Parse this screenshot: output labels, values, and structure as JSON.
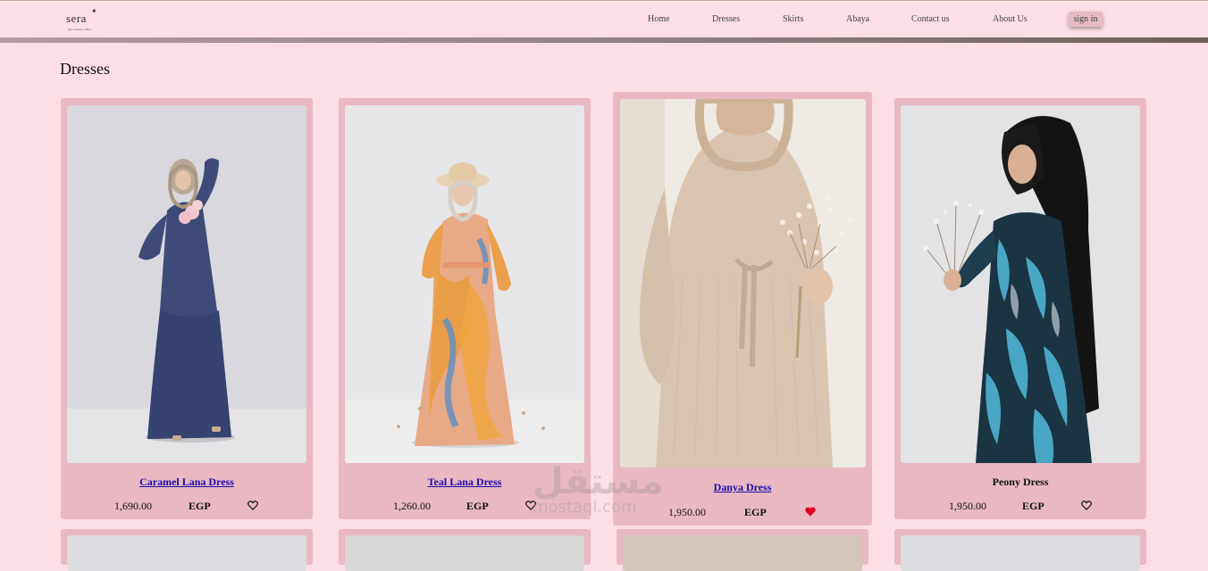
{
  "brand": {
    "name": "sera",
    "star": "✦",
    "tagline": "the modest office"
  },
  "nav": {
    "items": [
      {
        "label": "Home"
      },
      {
        "label": "Dresses"
      },
      {
        "label": "Skirts"
      },
      {
        "label": "Abaya"
      },
      {
        "label": "Contact us"
      },
      {
        "label": "About Us"
      }
    ],
    "signin": "sign in"
  },
  "section": {
    "title": "Dresses"
  },
  "products": [
    {
      "name": "Caramel Lana Dress",
      "price": "1,690.00",
      "currency": "EGP",
      "favorite": false
    },
    {
      "name": "Teal Lana Dress",
      "price": "1,260.00",
      "currency": "EGP",
      "favorite": false
    },
    {
      "name": "Danya Dress",
      "price": "1,950.00",
      "currency": "EGP",
      "favorite": true
    },
    {
      "name": "Peony Dress",
      "price": "1,950.00",
      "currency": "EGP",
      "favorite": false
    }
  ],
  "watermark": {
    "arabic": "مستقل",
    "latin": "mostaql.com"
  },
  "colors": {
    "background": "#fddde6",
    "card": "#e9b8c2",
    "link": "#1a0dab",
    "heart_active": "#e0001b"
  }
}
